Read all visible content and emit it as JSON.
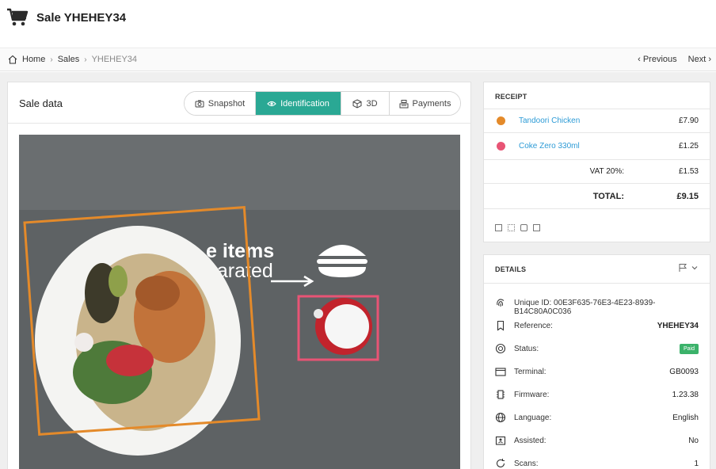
{
  "header": {
    "title": "Sale YHEHEY34",
    "icon": "shopping-cart-icon"
  },
  "breadcrumb": {
    "home": "Home",
    "sales": "Sales",
    "current": "YHEHEY34"
  },
  "pager": {
    "previous": "Previous",
    "next": "Next"
  },
  "sale": {
    "title": "Sale data",
    "tabs": [
      {
        "label": "Snapshot",
        "icon": "camera-icon"
      },
      {
        "label": "Identification",
        "icon": "eye-icon"
      },
      {
        "label": "3D",
        "icon": "cube-icon"
      },
      {
        "label": "Payments",
        "icon": "register-icon"
      }
    ],
    "active_tab": "Identification",
    "photo_text": {
      "line1": "e items",
      "line2": "parated"
    },
    "box_colors": {
      "item1": "#e48a2a",
      "item2": "#e85475"
    }
  },
  "receipt": {
    "caption": "RECEIPT",
    "items": [
      {
        "name": "Tandoori Chicken",
        "price": "£7.90",
        "color": "#e48a2a"
      },
      {
        "name": "Coke Zero 330ml",
        "price": "£1.25",
        "color": "#e85475"
      }
    ],
    "vat_label": "VAT 20%:",
    "vat_value": "£1.53",
    "total_label": "TOTAL:",
    "total_value": "£9.15"
  },
  "details": {
    "caption": "DETAILS",
    "unique_id_label": "Unique ID:",
    "unique_id_value": "00E3F635-76E3-4E23-8939-B14C80A0C036",
    "reference_label": "Reference:",
    "reference_value": "YHEHEY34",
    "status_label": "Status:",
    "status_value": "Paid",
    "terminal_label": "Terminal:",
    "terminal_value": "GB0093",
    "firmware_label": "Firmware:",
    "firmware_value": "1.23.38",
    "language_label": "Language:",
    "language_value": "English",
    "assisted_label": "Assisted:",
    "assisted_value": "No",
    "scans_label": "Scans:",
    "scans_value": "1"
  },
  "colors": {
    "accent": "#2aa894",
    "link": "#2d9bd6",
    "paid": "#3bb26a"
  }
}
